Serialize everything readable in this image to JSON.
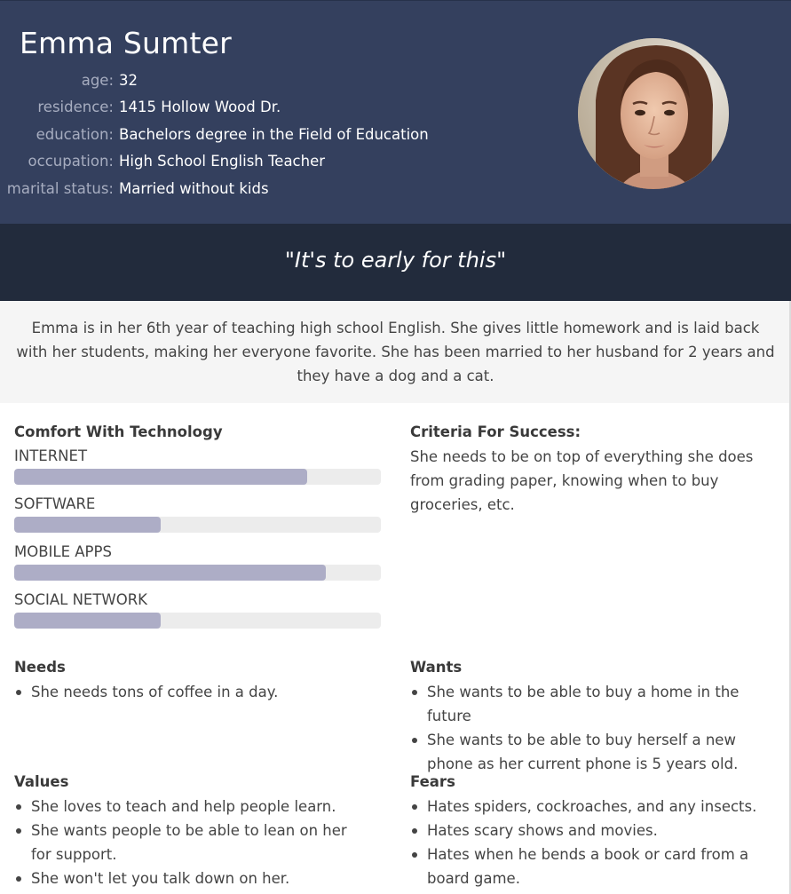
{
  "persona": {
    "name": "Emma Sumter",
    "facts": [
      {
        "label": "age:",
        "value": "32"
      },
      {
        "label": "residence:",
        "value": "1415 Hollow Wood Dr."
      },
      {
        "label": "education:",
        "value": "Bachelors degree in the Field of Education"
      },
      {
        "label": "occupation:",
        "value": "High School English Teacher"
      },
      {
        "label": "marital status:",
        "value": "Married without kids"
      }
    ],
    "quote": "\"It's to early for this\"",
    "bio": "Emma is in her 6th year of teaching high school English. She gives little homework and is laid back with her students, making her everyone favorite. She has been married to her husband for 2 years and they have a dog and a cat."
  },
  "technology": {
    "title": "Comfort With Technology",
    "skills": [
      {
        "label": "INTERNET",
        "level": 0.8
      },
      {
        "label": "SOFTWARE",
        "level": 0.4
      },
      {
        "label": "MOBILE APPS",
        "level": 0.85
      },
      {
        "label": "SOCIAL NETWORK",
        "level": 0.4
      }
    ]
  },
  "criteria": {
    "title": "Criteria For Success:",
    "text": "She needs to be on top of everything she does from grading paper, knowing when to buy groceries, etc."
  },
  "needs": {
    "title": "Needs",
    "items": [
      "She needs tons of coffee in a day."
    ]
  },
  "wants": {
    "title": "Wants",
    "items": [
      "She wants to be able to buy a home in the future",
      "She wants to be able to buy herself a new phone as her current phone is 5 years old."
    ]
  },
  "values": {
    "title": "Values",
    "items": [
      "She loves to teach and help people learn.",
      "She wants people to be able to lean on her for support.",
      "She won't let you talk down on her."
    ]
  },
  "fears": {
    "title": "Fears",
    "items": [
      "Hates spiders, cockroaches, and any insects.",
      "Hates scary shows and movies.",
      "Hates when he bends a book or card from a board game."
    ]
  },
  "colors": {
    "header_bg": "#34405e",
    "quote_bg": "#222b3c",
    "bio_bg": "#f5f5f5",
    "bar_fill": "#adadc6",
    "bar_track": "#ececec"
  }
}
